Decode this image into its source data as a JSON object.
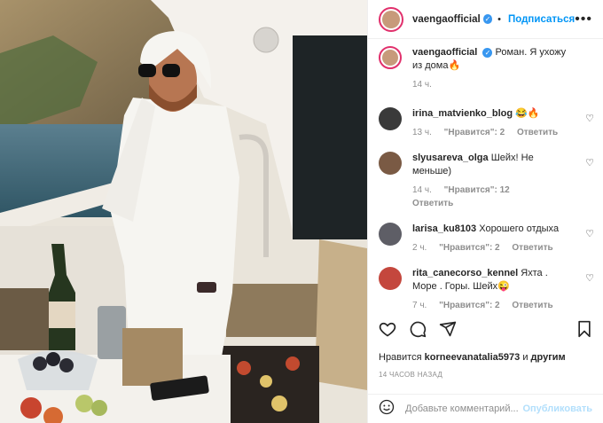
{
  "post": {
    "author": "vaengaofficial",
    "follow_label": "Подписаться",
    "more_label": "•••",
    "caption_user": "vaengaofficial",
    "caption_text": "Роман. Я ухожу из дома🔥",
    "caption_time": "14 ч."
  },
  "comments": [
    {
      "user": "irina_matvienko_blog",
      "text": "😂🔥",
      "time": "13 ч.",
      "likes": "\"Нравится\": 2",
      "reply": "Ответить"
    },
    {
      "user": "slyusareva_olga",
      "text": "Шейх! Не меньше)",
      "time": "14 ч.",
      "likes": "\"Нравится\": 12",
      "reply": "Ответить"
    },
    {
      "user": "larisa_ku8103",
      "text": "Хорошего отдыха",
      "time": "2 ч.",
      "likes": "\"Нравится\": 2",
      "reply": "Ответить"
    },
    {
      "user": "rita_canecorso_kennel",
      "text": "Яхта . Море . Горы. Шейх😜",
      "time": "7 ч.",
      "likes": "\"Нравится\": 2",
      "reply": "Ответить"
    }
  ],
  "likes_line": {
    "prefix": "Нравится",
    "user": "korneevanatalia5973",
    "and": "и",
    "others": "другим"
  },
  "date_label": "14 ЧАСОВ НАЗАД",
  "comment_box": {
    "placeholder": "Добавьте комментарий...",
    "publish": "Опубликовать"
  },
  "colors": {
    "accent": "#0095f6",
    "text": "#262626",
    "muted": "#8e8e8e",
    "verified": "#3897f0"
  }
}
